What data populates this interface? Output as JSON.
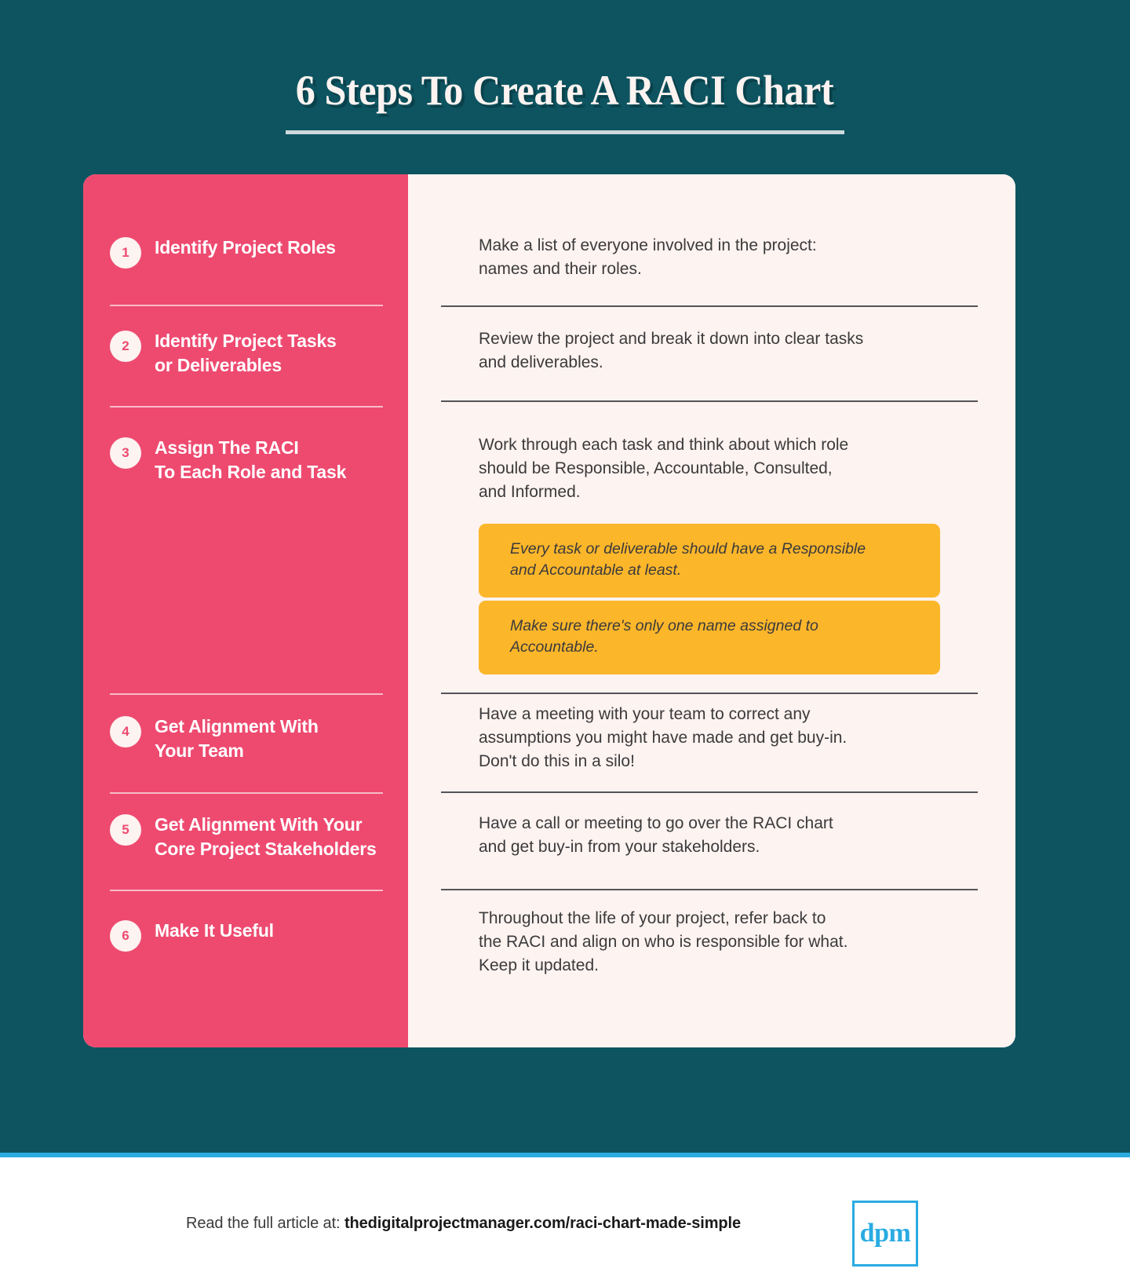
{
  "colors": {
    "background_teal": "#0d5460",
    "accent_pink": "#ee4a70",
    "panel_cream": "#fdf3f0",
    "callout_yellow": "#fcb62a",
    "logo_blue": "#29abe2",
    "body_text": "#3b3a3c"
  },
  "header": {
    "title": "6 Steps To Create A RACI Chart"
  },
  "steps": [
    {
      "number": "1",
      "label": "Identify Project Roles",
      "description": "Make a list of everyone involved in the project:\nnames and their roles.",
      "callouts": []
    },
    {
      "number": "2",
      "label": "Identify Project Tasks\nor Deliverables",
      "description": "Review the project and break it down into clear tasks\nand deliverables.",
      "callouts": []
    },
    {
      "number": "3",
      "label": "Assign The RACI\nTo Each Role and Task",
      "description": "Work through each task and think about which role\nshould be Responsible, Accountable, Consulted,\nand Informed.",
      "callouts": [
        "Every task or deliverable should have a Responsible\nand Accountable at least.",
        "Make sure there's only one name assigned to\nAccountable."
      ]
    },
    {
      "number": "4",
      "label": "Get Alignment With\nYour Team",
      "description": "Have a meeting with your team to correct any\nassumptions you might have made and get buy-in.\nDon't do this in a silo!",
      "callouts": []
    },
    {
      "number": "5",
      "label": "Get Alignment With Your\nCore Project Stakeholders",
      "description": "Have a call or meeting to go over the RACI chart\nand get buy-in from your stakeholders.",
      "callouts": []
    },
    {
      "number": "6",
      "label": "Make It Useful",
      "description": "Throughout the life of your project, refer back to\nthe RACI and align on who is responsible for what.\nKeep it updated.",
      "callouts": []
    }
  ],
  "footer": {
    "lead_text": "Read the full article at: ",
    "url": "thedigitalprojectmanager.com/raci-chart-made-simple",
    "logo_text": "dpm"
  }
}
